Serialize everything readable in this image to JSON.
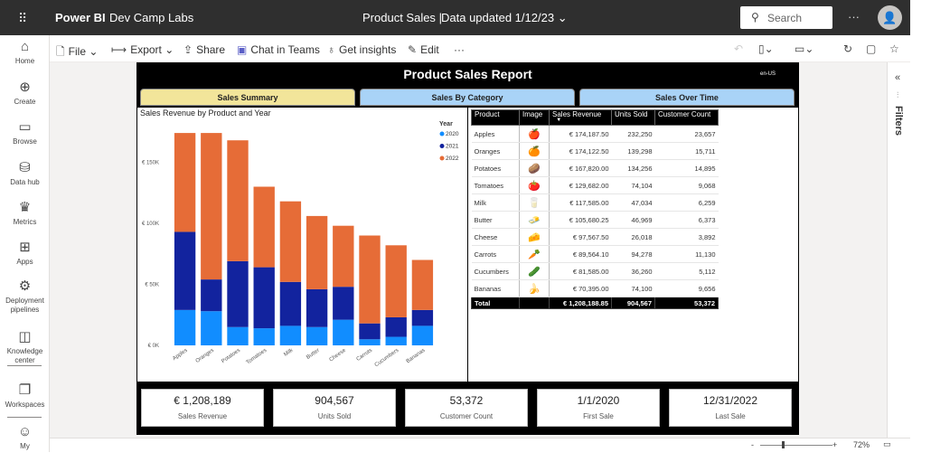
{
  "app": {
    "waffle_icon": "waffle-icon",
    "brand": "Power BI",
    "workspace": "Dev Camp Labs",
    "report_title": "Product Sales",
    "separator": "|",
    "data_updated": "Data updated 1/12/23",
    "search_placeholder": "Search",
    "more": "···",
    "avatar_icon": "person-icon"
  },
  "nav": [
    {
      "id": "home",
      "label": "Home",
      "icon": "⌂"
    },
    {
      "id": "create",
      "label": "Create",
      "icon": "⊕"
    },
    {
      "id": "browse",
      "label": "Browse",
      "icon": "▭"
    },
    {
      "id": "data-hub",
      "label": "Data hub",
      "icon": "⛁"
    },
    {
      "id": "metrics",
      "label": "Metrics",
      "icon": "♛"
    },
    {
      "id": "apps",
      "label": "Apps",
      "icon": "⊞"
    },
    {
      "id": "deployment-pipelines",
      "label": "Deployment pipelines",
      "icon": "⚙"
    },
    {
      "id": "knowledge-center",
      "label": "Knowledge center",
      "icon": "◫"
    },
    {
      "id": "workspaces",
      "label": "Workspaces",
      "icon": "❐"
    },
    {
      "id": "my",
      "label": "My",
      "icon": "☺"
    }
  ],
  "cmdbar": {
    "file": "File",
    "export": "Export",
    "share": "Share",
    "chat": "Chat in Teams",
    "insights": "Get insights",
    "edit": "Edit",
    "more": "···"
  },
  "filters_label": "Filters",
  "zoom": {
    "minus": "-",
    "plus": "+",
    "value": "72%"
  },
  "report": {
    "title": "Product Sales Report",
    "locale": "en-US",
    "tabs": [
      "Sales Summary",
      "Sales By Category",
      "Sales Over Time"
    ],
    "tab_colors": [
      "#f2e59a",
      "#a9d3f7",
      "#a9d3f7"
    ]
  },
  "chart_data": {
    "type": "bar",
    "stacked": true,
    "title": "Sales Revenue by Product and Year",
    "legend_title": "Year",
    "legend_position": "top-right",
    "categories": [
      "Apples",
      "Oranges",
      "Potatoes",
      "Tomatoes",
      "Milk",
      "Butter",
      "Cheese",
      "Carrots",
      "Cucumbers",
      "Bananas"
    ],
    "series": [
      {
        "name": "2020",
        "color": "#118dff",
        "values": [
          29000,
          28000,
          15000,
          14000,
          16000,
          15000,
          21000,
          5000,
          7000,
          16000
        ]
      },
      {
        "name": "2021",
        "color": "#12239e",
        "values": [
          64000,
          26000,
          54000,
          50000,
          36000,
          31000,
          27000,
          13000,
          16000,
          13000
        ]
      },
      {
        "name": "2022",
        "color": "#e66c37",
        "values": [
          81000,
          120000,
          99000,
          66000,
          66000,
          60000,
          50000,
          72000,
          59000,
          41000
        ]
      }
    ],
    "yticks": [
      0,
      50000,
      100000,
      150000
    ],
    "ytick_labels": [
      "€ 0K",
      "€ 50K",
      "€ 100K",
      "€ 150K"
    ],
    "ylim": [
      0,
      180000
    ],
    "grid": false
  },
  "table": {
    "columns": [
      "Product",
      "Image",
      "Sales Revenue",
      "Units Sold",
      "Customer Count"
    ],
    "sort_indicator": "▼",
    "rows": [
      {
        "product": "Apples",
        "icon": "🍎",
        "revenue": "€ 174,187.50",
        "units": "232,250",
        "customers": "23,657"
      },
      {
        "product": "Oranges",
        "icon": "🍊",
        "revenue": "€ 174,122.50",
        "units": "139,298",
        "customers": "15,711"
      },
      {
        "product": "Potatoes",
        "icon": "🥔",
        "revenue": "€ 167,820.00",
        "units": "134,256",
        "customers": "14,895"
      },
      {
        "product": "Tomatoes",
        "icon": "🍅",
        "revenue": "€ 129,682.00",
        "units": "74,104",
        "customers": "9,068"
      },
      {
        "product": "Milk",
        "icon": "🥛",
        "revenue": "€ 117,585.00",
        "units": "47,034",
        "customers": "6,259"
      },
      {
        "product": "Butter",
        "icon": "🧈",
        "revenue": "€ 105,680.25",
        "units": "46,969",
        "customers": "6,373"
      },
      {
        "product": "Cheese",
        "icon": "🧀",
        "revenue": "€ 97,567.50",
        "units": "26,018",
        "customers": "3,892"
      },
      {
        "product": "Carrots",
        "icon": "🥕",
        "revenue": "€ 89,564.10",
        "units": "94,278",
        "customers": "11,130"
      },
      {
        "product": "Cucumbers",
        "icon": "🥒",
        "revenue": "€ 81,585.00",
        "units": "36,260",
        "customers": "5,112"
      },
      {
        "product": "Bananas",
        "icon": "🍌",
        "revenue": "€ 70,395.00",
        "units": "74,100",
        "customers": "9,656"
      }
    ],
    "total": {
      "label": "Total",
      "revenue": "€ 1,208,188.85",
      "units": "904,567",
      "customers": "53,372"
    }
  },
  "kpis": [
    {
      "value": "€ 1,208,189",
      "label": "Sales Revenue"
    },
    {
      "value": "904,567",
      "label": "Units Sold"
    },
    {
      "value": "53,372",
      "label": "Customer Count"
    },
    {
      "value": "1/1/2020",
      "label": "First Sale"
    },
    {
      "value": "12/31/2022",
      "label": "Last Sale"
    }
  ]
}
